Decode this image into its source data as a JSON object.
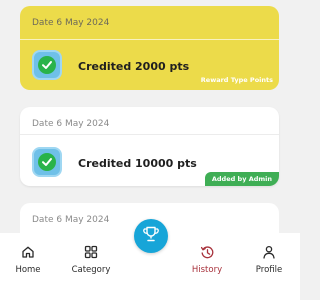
{
  "cards": [
    {
      "date": "Date 6 May 2024",
      "title": "Credited 2000 pts",
      "tag": "Reward Type Points"
    },
    {
      "date": "Date 6 May 2024",
      "title": "Credited 10000 pts",
      "tag": "Added by Admin"
    },
    {
      "date": "Date 6 May 2024"
    }
  ],
  "nav": {
    "home": "Home",
    "category": "Category",
    "history": "History",
    "profile": "Profile"
  },
  "icons": {
    "check": "check-icon",
    "home": "home-icon",
    "category": "grid-icon",
    "trophy": "trophy-icon",
    "history": "history-icon",
    "profile": "person-icon"
  },
  "colors": {
    "highlight_card": "#ecdb4a",
    "badge_green": "#3fae55",
    "fab_blue": "#17a5d8",
    "active_nav": "#a8323c"
  }
}
